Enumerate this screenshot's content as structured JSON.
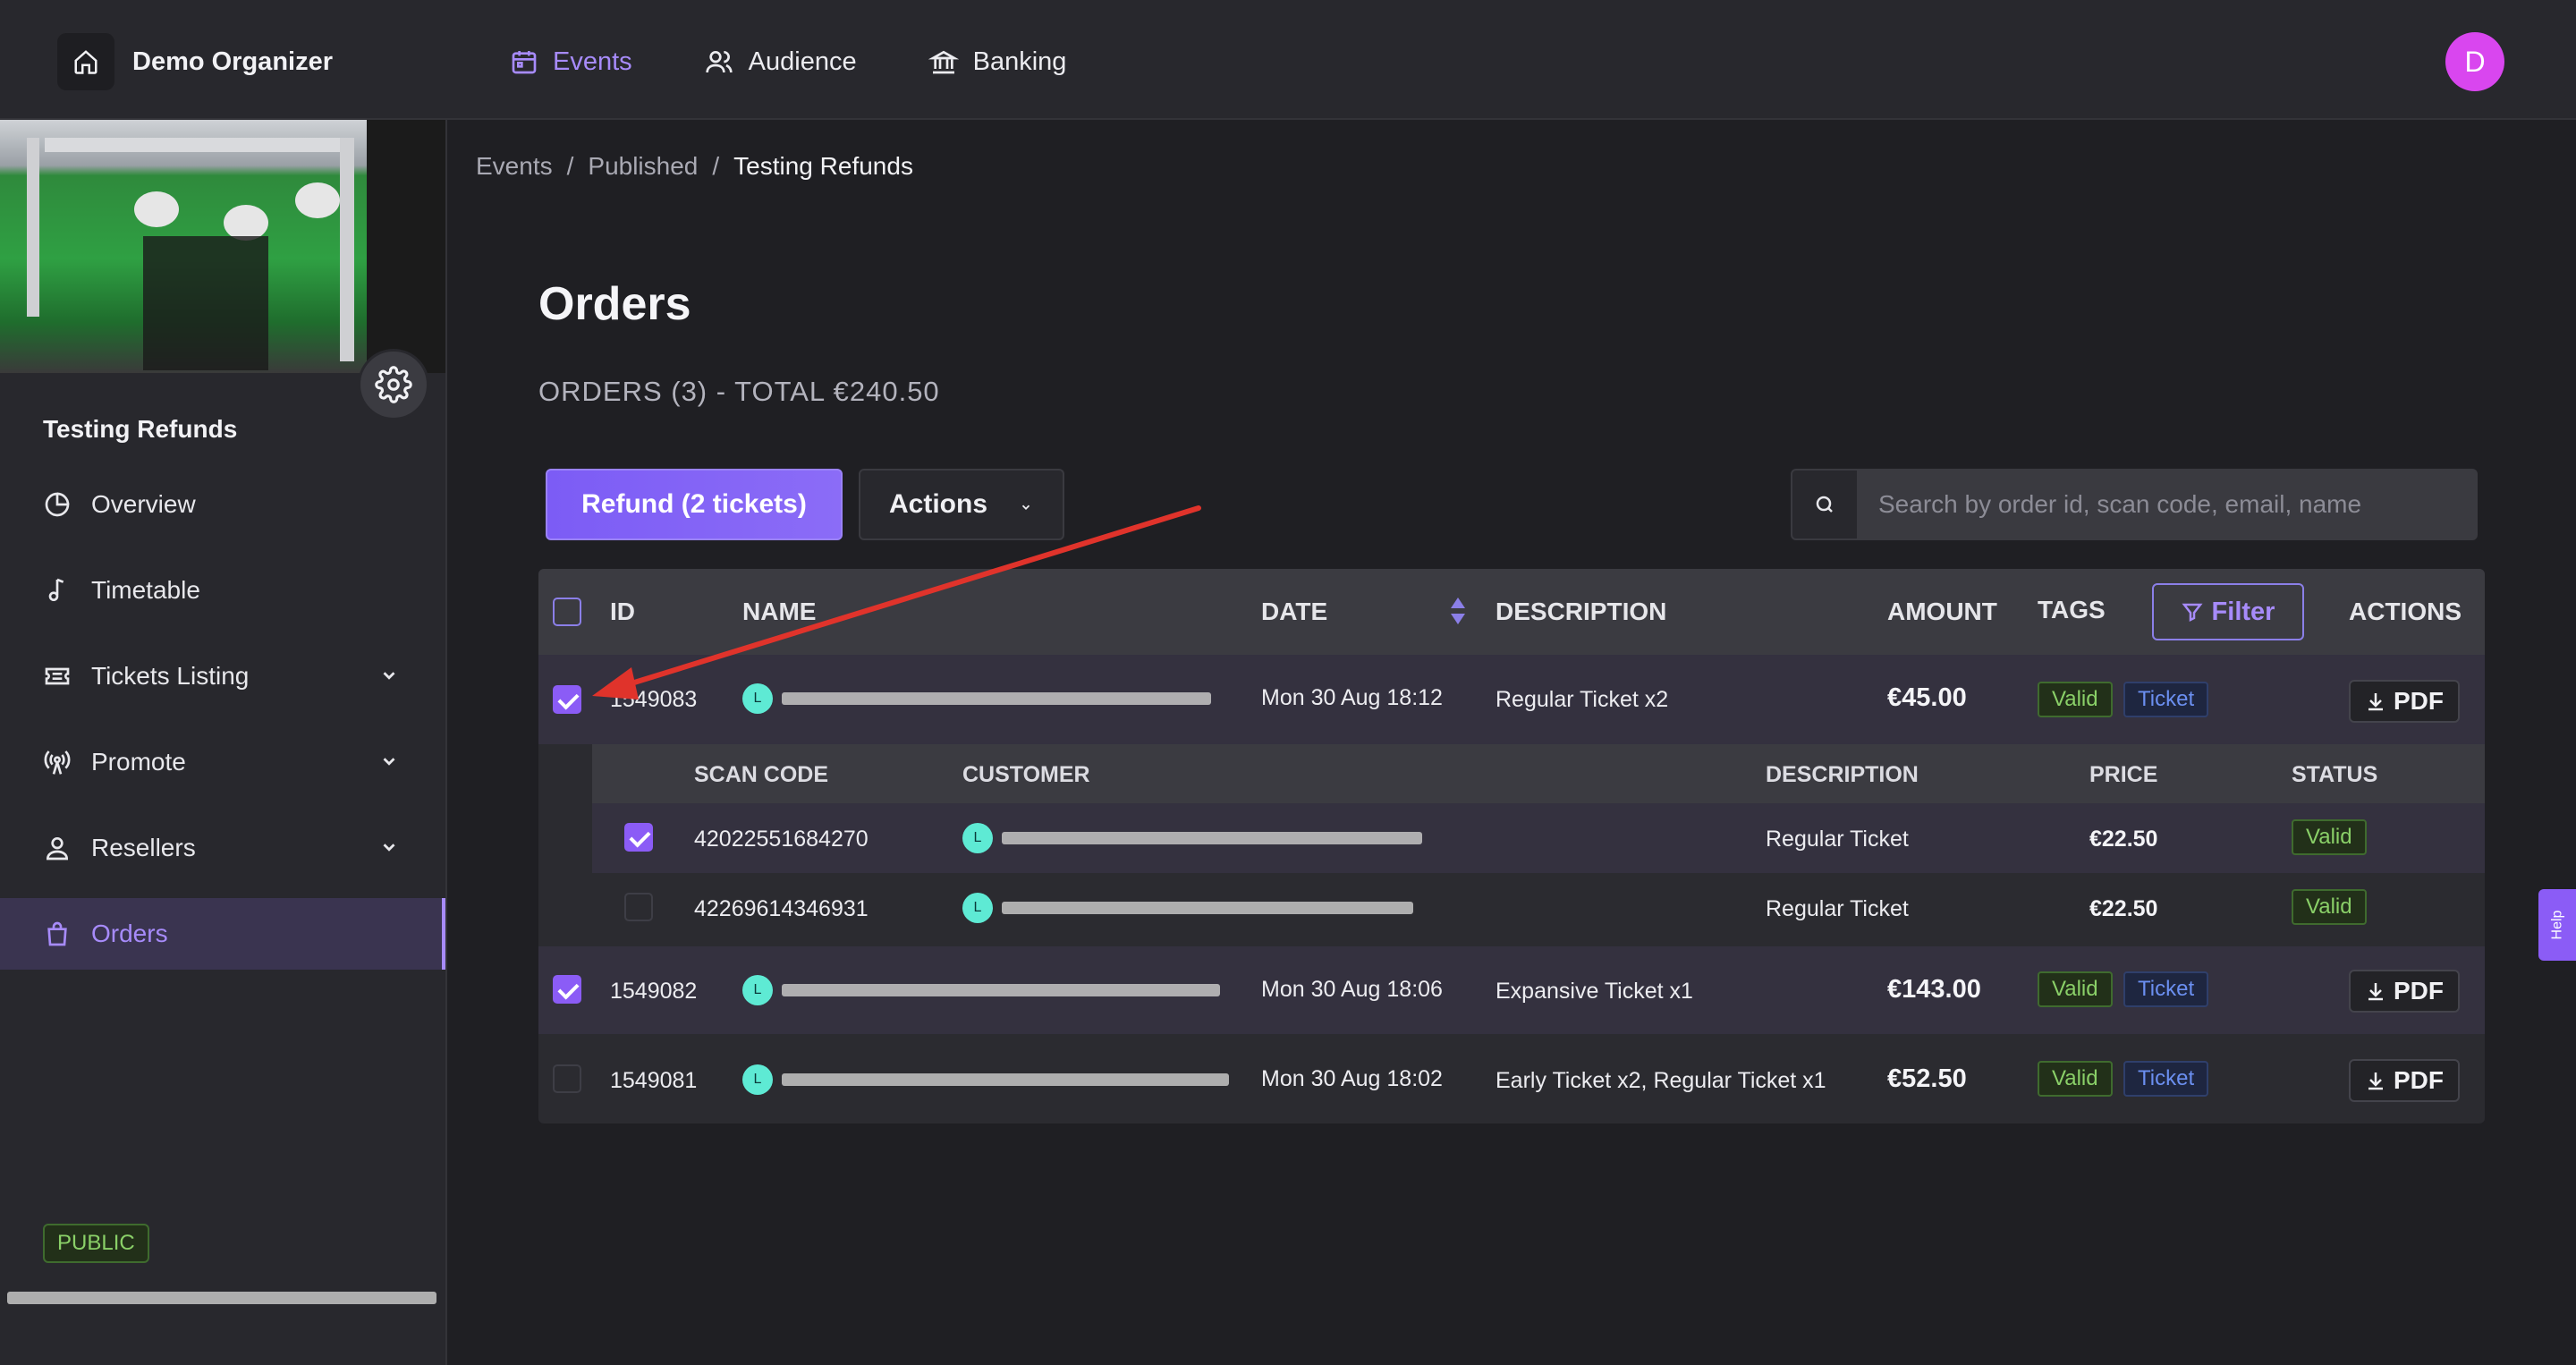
{
  "topbar": {
    "brand": "Demo Organizer",
    "nav": [
      {
        "label": "Events",
        "icon": "calendar-icon",
        "active": true
      },
      {
        "label": "Audience",
        "icon": "users-icon"
      },
      {
        "label": "Banking",
        "icon": "bank-icon"
      }
    ],
    "avatar_initial": "D"
  },
  "sidebar": {
    "event_title": "Testing Refunds",
    "items": [
      {
        "label": "Overview",
        "icon": "pie-chart-icon"
      },
      {
        "label": "Timetable",
        "icon": "music-note-icon"
      },
      {
        "label": "Tickets Listing",
        "icon": "ticket-icon",
        "expandable": true
      },
      {
        "label": "Promote",
        "icon": "broadcast-icon",
        "expandable": true
      },
      {
        "label": "Resellers",
        "icon": "user-icon",
        "expandable": true
      },
      {
        "label": "Orders",
        "icon": "shopping-bag-icon",
        "active": true
      }
    ],
    "status_badge": "PUBLIC"
  },
  "breadcrumb": [
    "Events",
    "Published",
    "Testing Refunds"
  ],
  "page": {
    "title": "Orders",
    "summary": "ORDERS (3) - TOTAL €240.50"
  },
  "toolbar": {
    "refund_label": "Refund (2 tickets)",
    "actions_label": "Actions",
    "search_placeholder": "Search by order id, scan code, email, name"
  },
  "table": {
    "headers": {
      "id": "ID",
      "name": "NAME",
      "date": "DATE",
      "description": "DESCRIPTION",
      "amount": "AMOUNT",
      "tags": "TAGS",
      "filter": "Filter",
      "actions": "ACTIONS"
    },
    "rows": [
      {
        "id": "1549083",
        "avatar": "L",
        "date": "Mon 30 Aug 18:12",
        "description": "Regular Ticket x2",
        "amount": "€45.00",
        "tags": [
          "Valid",
          "Ticket"
        ],
        "action": "PDF",
        "checked": true
      },
      {
        "id": "1549082",
        "avatar": "L",
        "date": "Mon 30 Aug 18:06",
        "description": "Expansive Ticket x1",
        "amount": "€143.00",
        "tags": [
          "Valid",
          "Ticket"
        ],
        "action": "PDF",
        "checked": true
      },
      {
        "id": "1549081",
        "avatar": "L",
        "date": "Mon 30 Aug 18:02",
        "description": "Early Ticket x2, Regular Ticket x1",
        "amount": "€52.50",
        "tags": [
          "Valid",
          "Ticket"
        ],
        "action": "PDF",
        "checked": false
      }
    ],
    "sub_headers": {
      "scan_code": "SCAN CODE",
      "customer": "CUSTOMER",
      "description": "DESCRIPTION",
      "price": "PRICE",
      "status": "STATUS"
    },
    "sub_rows": [
      {
        "scan_code": "42022551684270",
        "avatar": "L",
        "description": "Regular Ticket",
        "price": "€22.50",
        "status": "Valid",
        "checked": true
      },
      {
        "scan_code": "42269614346931",
        "avatar": "L",
        "description": "Regular Ticket",
        "price": "€22.50",
        "status": "Valid",
        "checked": false
      }
    ]
  },
  "help_label": "Help",
  "colors": {
    "accent": "#8b5cf6",
    "valid": "#8ad068",
    "ticket": "#6b8ff0",
    "annotation_arrow": "#e0332b"
  }
}
